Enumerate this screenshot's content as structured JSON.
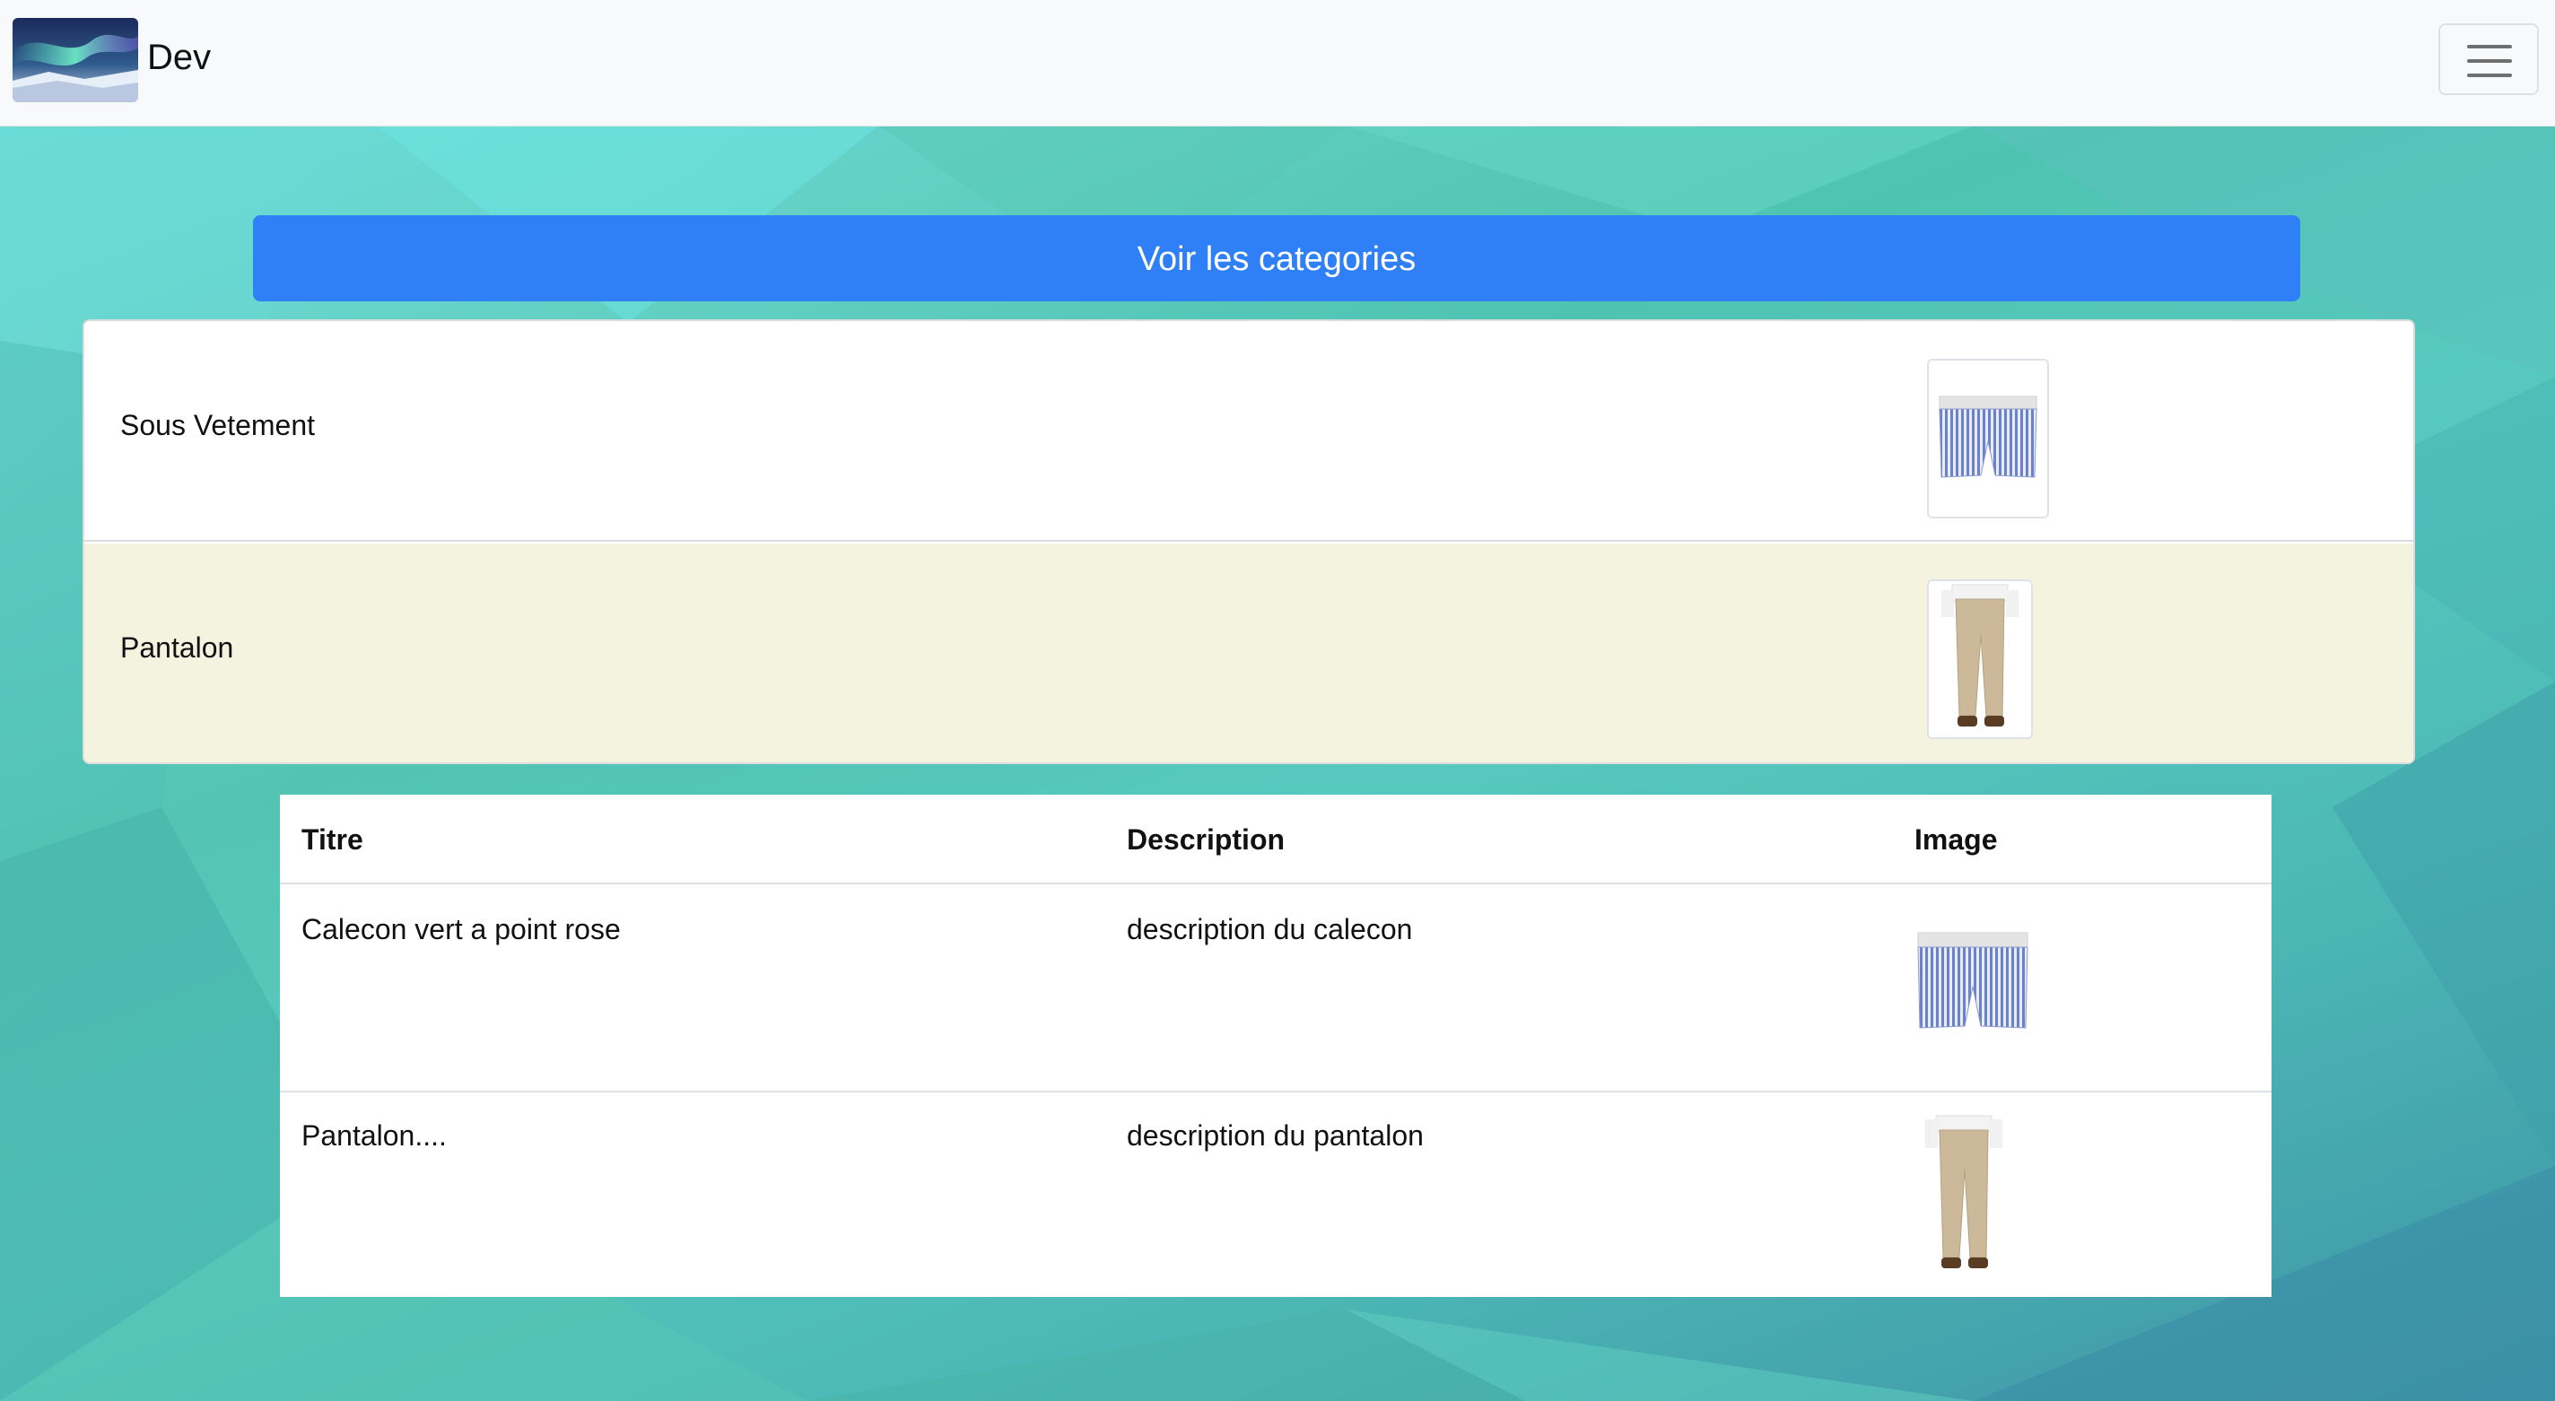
{
  "navbar": {
    "brand": "Dev",
    "brand_image": "aurora-landscape",
    "toggler_icon": "hamburger-menu-icon"
  },
  "categories_button": {
    "label": "Voir les categories"
  },
  "categories": [
    {
      "label": "Sous Vetement",
      "image": "boxer-shorts-image"
    },
    {
      "label": "Pantalon",
      "image": "trousers-image"
    }
  ],
  "products": {
    "headers": [
      "Titre",
      "Description",
      "Image"
    ],
    "rows": [
      {
        "titre": "Calecon vert a point rose",
        "description": "description du calecon",
        "image": "boxer-shorts-image"
      },
      {
        "titre": "Pantalon....",
        "description": "description du pantalon",
        "image": "trousers-image"
      }
    ]
  },
  "colors": {
    "navbar_bg": "#f8f9fa",
    "primary": "#2f80f7",
    "highlight_row": "#f4f3e0",
    "background_teal": "#57c9be"
  }
}
